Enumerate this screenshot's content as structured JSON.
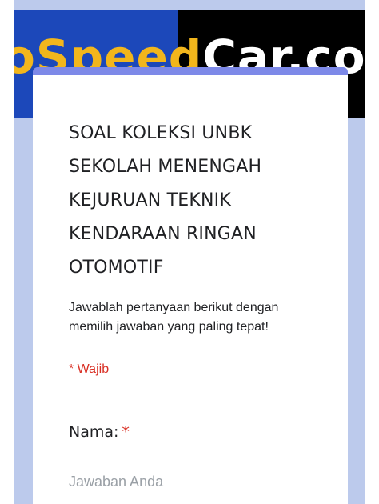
{
  "banner": {
    "text_part_a": "oSpeed",
    "text_part_b": "Car.co",
    "colors": {
      "left_bg": "#1c48ba",
      "right_bg": "#000000",
      "text_a": "#f2b61c",
      "text_b": "#ffffff"
    }
  },
  "form": {
    "title": "SOAL KOLEKSI UNBK SEKOLAH MENENGAH KEJURUAN TEKNIK KENDARAAN RINGAN OTOMOTIF",
    "description": "Jawablah pertanyaan berikut dengan memilih jawaban yang paling tepat!",
    "required_note": "* Wajib",
    "accent_color": "#7d89e8",
    "page_background": "#bccaec"
  },
  "question": {
    "label": "Nama:",
    "required_mark": "*",
    "placeholder": "Jawaban Anda",
    "value": ""
  }
}
